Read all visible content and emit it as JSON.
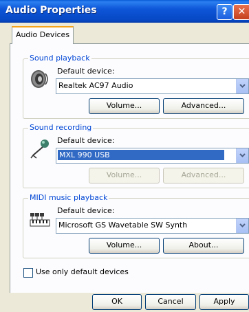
{
  "window": {
    "title": "Audio Properties"
  },
  "titlebar": {
    "help_glyph": "?",
    "close_glyph": "✕"
  },
  "tabs": [
    {
      "label": "Audio Devices"
    }
  ],
  "playback": {
    "legend": "Sound playback",
    "label": "Default device:",
    "device": "Realtek AC97 Audio",
    "volume": "Volume...",
    "advanced": "Advanced..."
  },
  "recording": {
    "legend": "Sound recording",
    "label": "Default device:",
    "device": "MXL 990 USB",
    "volume": "Volume...",
    "advanced": "Advanced..."
  },
  "midi": {
    "legend": "MIDI music playback",
    "label": "Default device:",
    "device": "Microsoft GS Wavetable SW Synth",
    "volume": "Volume...",
    "about": "About..."
  },
  "options": {
    "use_default_only": "Use only default devices",
    "checked": false
  },
  "footer": {
    "ok": "OK",
    "cancel": "Cancel",
    "apply": "Apply"
  },
  "colors": {
    "titlebar": "#0a5bd6",
    "legend": "#0046d5",
    "selection": "#316ac5"
  }
}
